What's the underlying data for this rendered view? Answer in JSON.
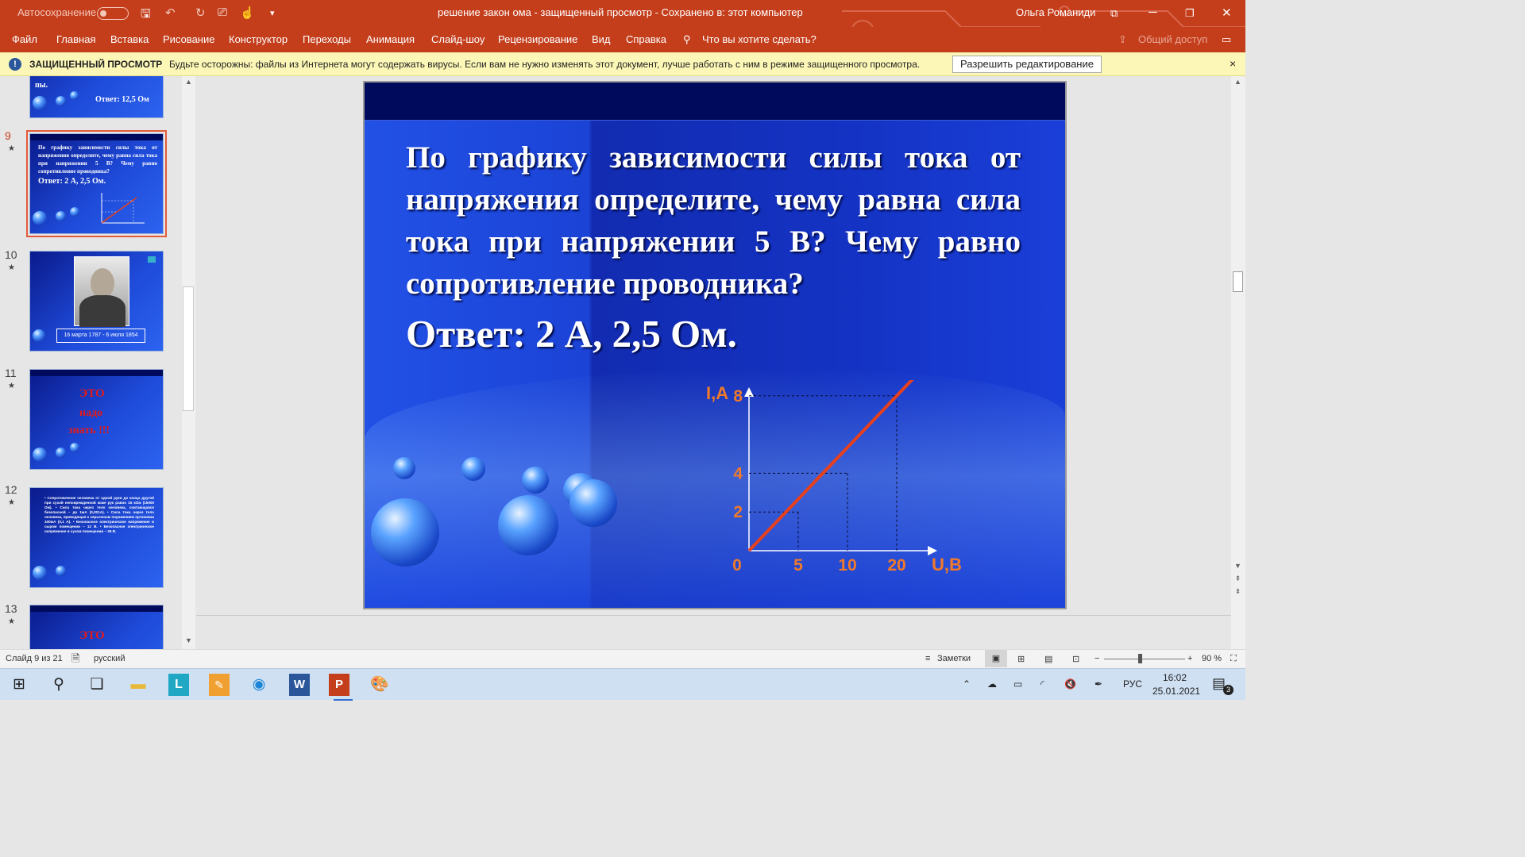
{
  "titlebar": {
    "autosave_label": "Автосохранение",
    "document_title": "решение закон ома  -  защищенный просмотр  -  Сохранено в: этот компьютер",
    "user_name": "Ольга Романиди"
  },
  "menu": {
    "items": [
      "Файл",
      "Главная",
      "Вставка",
      "Рисование",
      "Конструктор",
      "Переходы",
      "Анимация",
      "Слайд-шоу",
      "Рецензирование",
      "Вид",
      "Справка"
    ],
    "search_placeholder": "Что вы хотите сделать?",
    "share_label": "Общий доступ"
  },
  "protected": {
    "title": "ЗАЩИЩЕННЫЙ ПРОСМОТР",
    "message": "Будьте осторожны: файлы из Интернета могут содержать вирусы. Если вам не нужно изменять этот документ, лучше работать с ним в режиме защищенного просмотра.",
    "button": "Разрешить редактирование",
    "close": "×"
  },
  "thumbnails": {
    "prev_answer_partial": "Ответ: 12,5 Ом",
    "prev_partial_line": "пы.",
    "slides": [
      {
        "num": "9",
        "star": "★",
        "text": "По графику зависимости силы тока от напряжения определите, чему равна сила тока при напряжении 5 В? Чему равно сопротивление проводника?",
        "answer": "Ответ: 2 А, 2,5 Ом."
      },
      {
        "num": "10",
        "star": "★",
        "caption": "16 марта 1787 - 6 июля 1854"
      },
      {
        "num": "11",
        "star": "★",
        "lines": [
          "ЭТО",
          "надо",
          "знать !!!"
        ]
      },
      {
        "num": "12",
        "star": "★",
        "text": "• Сопротивление человека от одной руки до конца другой при сухой неповрежденной коже рук равно 15 кОм (15000 Ом). • Сила тока через тело человека, считающаяся безопасной – до 1мА (0,001А). • Сила тока через тело человека, приводящая к серьезным поражениям организма 100мА (0,1 А). • Безопасное электрическое напряжение в сыром помещении – 12 В. • Безопасное электрическое напряжение в сухом помещении – 36 В."
      },
      {
        "num": "13",
        "star": "★",
        "lines": [
          "ЭТО"
        ]
      }
    ]
  },
  "slide": {
    "question": "По графику зависимости силы тока от напряжения определите, чему равна сила тока при напряжении 5 В? Чему равно сопротивление проводника?",
    "answer": "Ответ: 2 А,  2,5 Ом."
  },
  "chart_data": {
    "type": "line",
    "ylabel": "I,A",
    "xlabel": "U,B",
    "x_ticks": [
      "0",
      "5",
      "10",
      "20"
    ],
    "y_ticks": [
      "2",
      "4",
      "8"
    ],
    "points": [
      {
        "x": "0",
        "y": 0
      },
      {
        "x": "5",
        "y": 2
      },
      {
        "x": "10",
        "y": 4
      },
      {
        "x": "20",
        "y": 8
      }
    ],
    "line_color": "#e8401c",
    "label_color": "#f07a2a"
  },
  "status": {
    "slide_counter": "Слайд 9 из 21",
    "language": "русский",
    "notes": "Заметки",
    "zoom": "90 %"
  },
  "taskbar": {
    "lang": "РУС",
    "time": "16:02",
    "date": "25.01.2021",
    "notif_count": "3"
  }
}
